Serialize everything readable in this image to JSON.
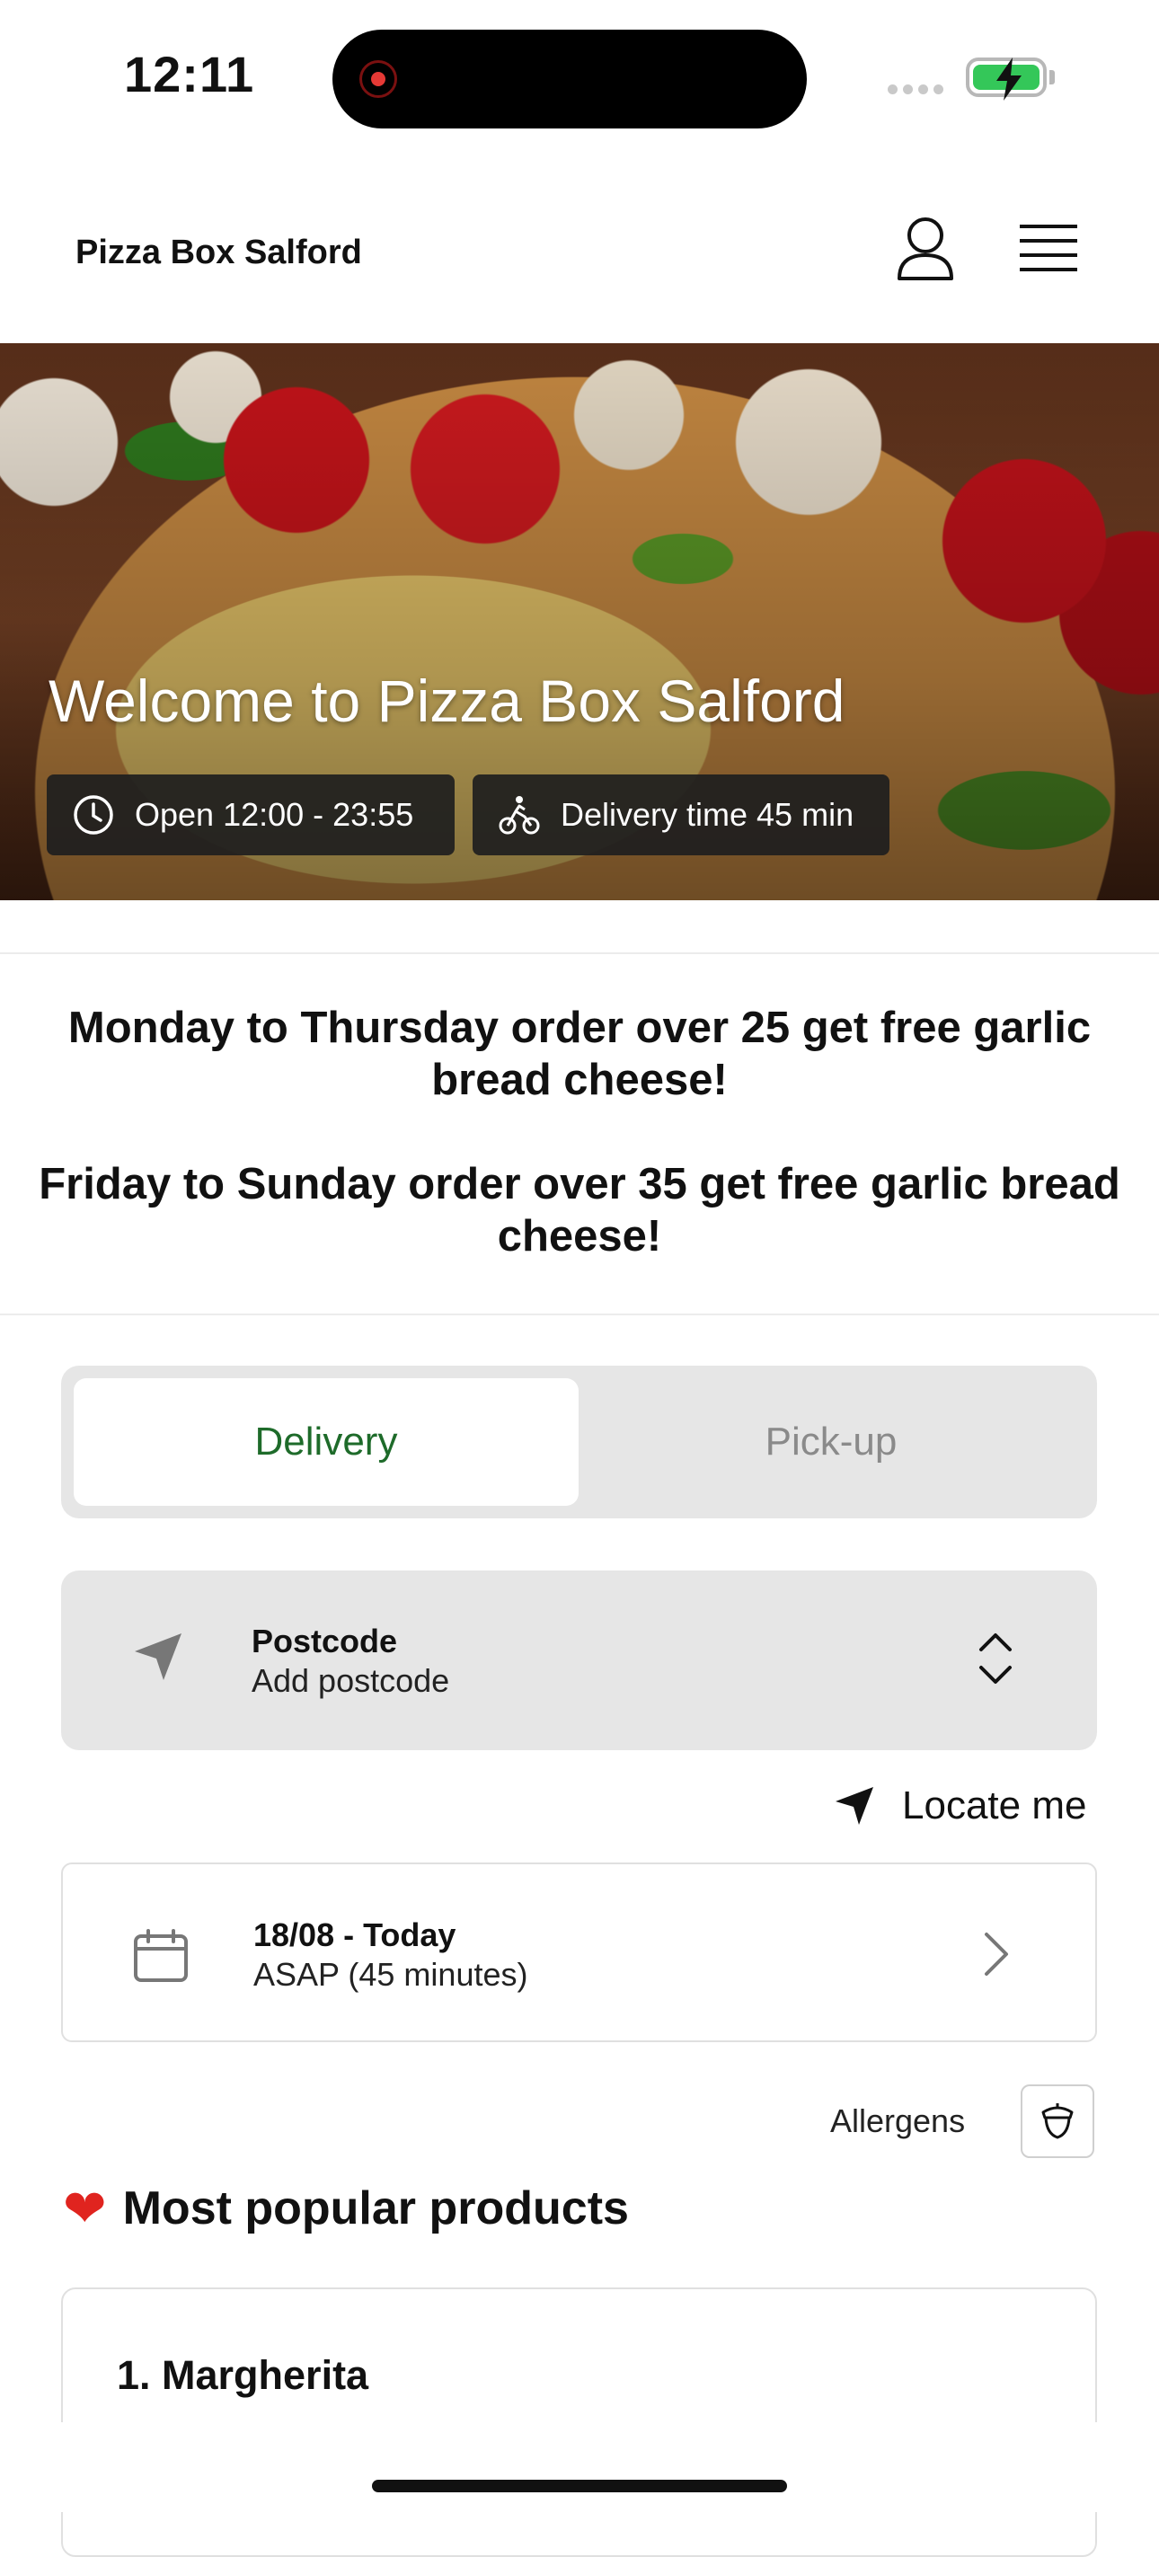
{
  "status_bar": {
    "time": "12:11",
    "battery_color": "#34c759"
  },
  "header": {
    "brand": "Pizza Box Salford",
    "icons": [
      "user-icon",
      "menu-icon"
    ]
  },
  "hero": {
    "title": "Welcome to Pizza Box Salford",
    "open_hours": "Open 12:00 - 23:55",
    "delivery_time": "Delivery time 45 min"
  },
  "promo": {
    "line1": "Monday to Thursday order over 25 get free garlic bread cheese!",
    "line2": "Friday to Sunday order over 35 get free garlic bread cheese!"
  },
  "order_mode": {
    "options": [
      "Delivery",
      "Pick-up"
    ],
    "selected": "Delivery",
    "active_color": "#1e6b2a"
  },
  "postcode": {
    "label": "Postcode",
    "placeholder": "Add postcode"
  },
  "locate": {
    "label": "Locate me"
  },
  "schedule": {
    "date": "18/08 - Today",
    "time": "ASAP (45 minutes)"
  },
  "allergens": {
    "label": "Allergens"
  },
  "popular": {
    "heading": "Most popular products",
    "emoji": "❤",
    "products": [
      "1. Margherita"
    ]
  }
}
